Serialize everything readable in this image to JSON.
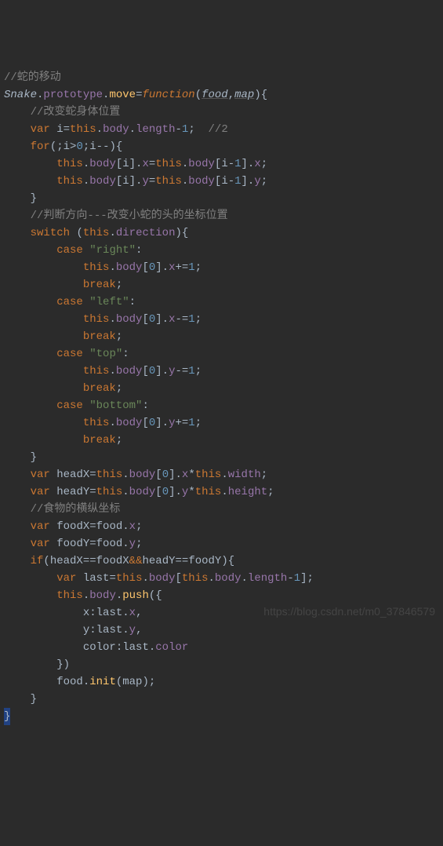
{
  "line1": "//蛇的移动",
  "l2": {
    "snake": "Snake",
    "proto": "prototype",
    "move": "move",
    "fn": "function",
    "p1": "food",
    "p2": "map"
  },
  "l3": "//改变蛇身体位置",
  "l4": {
    "var": "var",
    "i": "i",
    "this": "this",
    "body": "body",
    "length": "length",
    "one": "1",
    "cm": "//2"
  },
  "l5": {
    "for": "for",
    "i": "i",
    "zero": "0"
  },
  "l6": {
    "this": "this",
    "body": "body",
    "i": "i",
    "x": "x",
    "one": "1"
  },
  "l7": {
    "this": "this",
    "body": "body",
    "i": "i",
    "y": "y",
    "one": "1"
  },
  "l9": "//判断方向---改变小蛇的头的坐标位置",
  "l10": {
    "switch": "switch",
    "this": "this",
    "direction": "direction"
  },
  "case_right": {
    "case": "case",
    "val": "\"right\""
  },
  "cr_body": {
    "this": "this",
    "body": "body",
    "zero": "0",
    "x": "x",
    "one": "1"
  },
  "case_left": {
    "case": "case",
    "val": "\"left\""
  },
  "cl_body": {
    "this": "this",
    "body": "body",
    "zero": "0",
    "x": "x",
    "one": "1"
  },
  "case_top": {
    "case": "case",
    "val": "\"top\""
  },
  "ct_body": {
    "this": "this",
    "body": "body",
    "zero": "0",
    "y": "y",
    "one": "1"
  },
  "case_bottom": {
    "case": "case",
    "val": "\"bottom\""
  },
  "cb_body": {
    "this": "this",
    "body": "body",
    "zero": "0",
    "y": "y",
    "one": "1"
  },
  "break": "break",
  "hx": {
    "var": "var",
    "name": "headX",
    "this": "this",
    "body": "body",
    "zero": "0",
    "x": "x",
    "width": "width"
  },
  "hy": {
    "var": "var",
    "name": "headY",
    "this": "this",
    "body": "body",
    "zero": "0",
    "y": "y",
    "height": "height"
  },
  "l_coord": "//食物的横纵坐标",
  "fx": {
    "var": "var",
    "name": "foodX",
    "food": "food",
    "x": "x"
  },
  "fy": {
    "var": "var",
    "name": "foodY",
    "food": "food",
    "y": "y"
  },
  "ifline": {
    "if": "if",
    "hx": "headX",
    "fx": "foodX",
    "and": "&&",
    "hy": "headY",
    "fy": "foodY"
  },
  "last": {
    "var": "var",
    "name": "last",
    "this": "this",
    "body": "body",
    "length": "length",
    "one": "1"
  },
  "push": {
    "this": "this",
    "body": "body",
    "push": "push"
  },
  "px": {
    "x": "x",
    "last": "last"
  },
  "py": {
    "y": "y",
    "last": "last"
  },
  "pc": {
    "color": "color",
    "last": "last"
  },
  "finit": {
    "food": "food",
    "init": "init",
    "map": "map"
  },
  "watermark": "https://blog.csdn.net/m0_37846579"
}
